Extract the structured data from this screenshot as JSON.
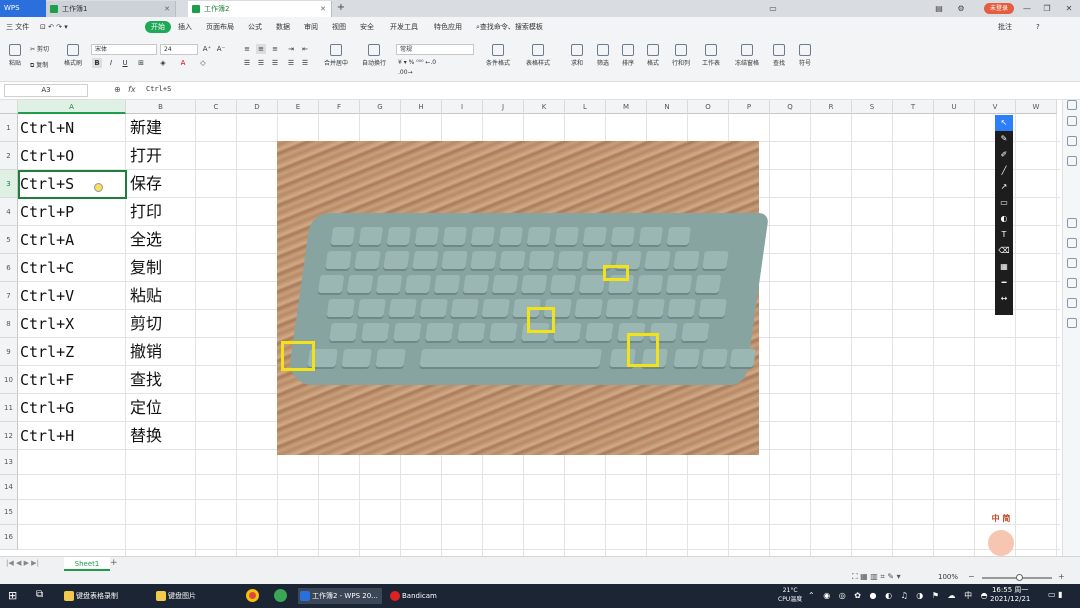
{
  "tabbar": {
    "wps": "WPS",
    "tabs": [
      {
        "label": "工作簿1",
        "active": false
      },
      {
        "label": "工作簿2",
        "active": true
      }
    ],
    "new_tab": "+",
    "login": "未登录"
  },
  "menubar": {
    "file": "三 文件",
    "items": [
      "开始",
      "插入",
      "页面布局",
      "公式",
      "数据",
      "审阅",
      "视图",
      "安全",
      "开发工具",
      "特色应用"
    ],
    "search": "查找命令、搜索模板",
    "annotate": "批注",
    "help": "?"
  },
  "ribbon": {
    "paste": "粘贴",
    "cut": "剪切",
    "copy": "复制",
    "format_painter": "格式刷",
    "font": "宋体",
    "size": "24",
    "merge": "合并居中",
    "wrap": "自动换行",
    "number_format": "常规",
    "cond_format": "条件格式",
    "table_style": "表格样式",
    "sum": "求和",
    "filter": "筛选",
    "sort": "排序",
    "format": "格式",
    "rowcol": "行和列",
    "worksheet": "工作表",
    "freeze": "冻结窗格",
    "find": "查找",
    "symbol": "符号"
  },
  "formulabar": {
    "namebox": "A3",
    "fx": "fx",
    "content": "Ctrl+S"
  },
  "columns": [
    "A",
    "B",
    "C",
    "D",
    "E",
    "F",
    "G",
    "H",
    "I",
    "J",
    "K",
    "L",
    "M",
    "N",
    "O",
    "P",
    "Q",
    "R",
    "S",
    "T",
    "U",
    "V",
    "W"
  ],
  "rows": [
    {
      "num": "1",
      "a": "Ctrl+N",
      "b": "新建"
    },
    {
      "num": "2",
      "a": "Ctrl+O",
      "b": "打开"
    },
    {
      "num": "3",
      "a": "Ctrl+S",
      "b": "保存"
    },
    {
      "num": "4",
      "a": "Ctrl+P",
      "b": "打印"
    },
    {
      "num": "5",
      "a": "Ctrl+A",
      "b": "全选"
    },
    {
      "num": "6",
      "a": "Ctrl+C",
      "b": "复制"
    },
    {
      "num": "7",
      "a": "Ctrl+V",
      "b": "粘贴"
    },
    {
      "num": "8",
      "a": "Ctrl+X",
      "b": "剪切"
    },
    {
      "num": "9",
      "a": "Ctrl+Z",
      "b": "撤销"
    },
    {
      "num": "10",
      "a": "Ctrl+F",
      "b": "查找"
    },
    {
      "num": "11",
      "a": "Ctrl+G",
      "b": "定位"
    },
    {
      "num": "12",
      "a": "Ctrl+H",
      "b": "替换"
    },
    {
      "num": "13",
      "a": "",
      "b": ""
    },
    {
      "num": "14",
      "a": "",
      "b": ""
    },
    {
      "num": "15",
      "a": "",
      "b": ""
    },
    {
      "num": "16",
      "a": "",
      "b": ""
    }
  ],
  "sheet": {
    "name": "Sheet1",
    "add": "+"
  },
  "status": {
    "zoom": "100%"
  },
  "taskbar": {
    "items": [
      "键盘表格录制",
      "键盘图片",
      "工作簿2 - WPS 20...",
      "Bandicam"
    ],
    "weather_temp": "21°C",
    "weather_label": "CPU温度",
    "time": "16:55 周一",
    "date": "2021/12/21"
  },
  "watermark": {
    "text": "中 简"
  },
  "colors": {
    "accent": "#1e9e4a",
    "highlight": "#f1e21a",
    "taskbar": "#1c2533"
  }
}
